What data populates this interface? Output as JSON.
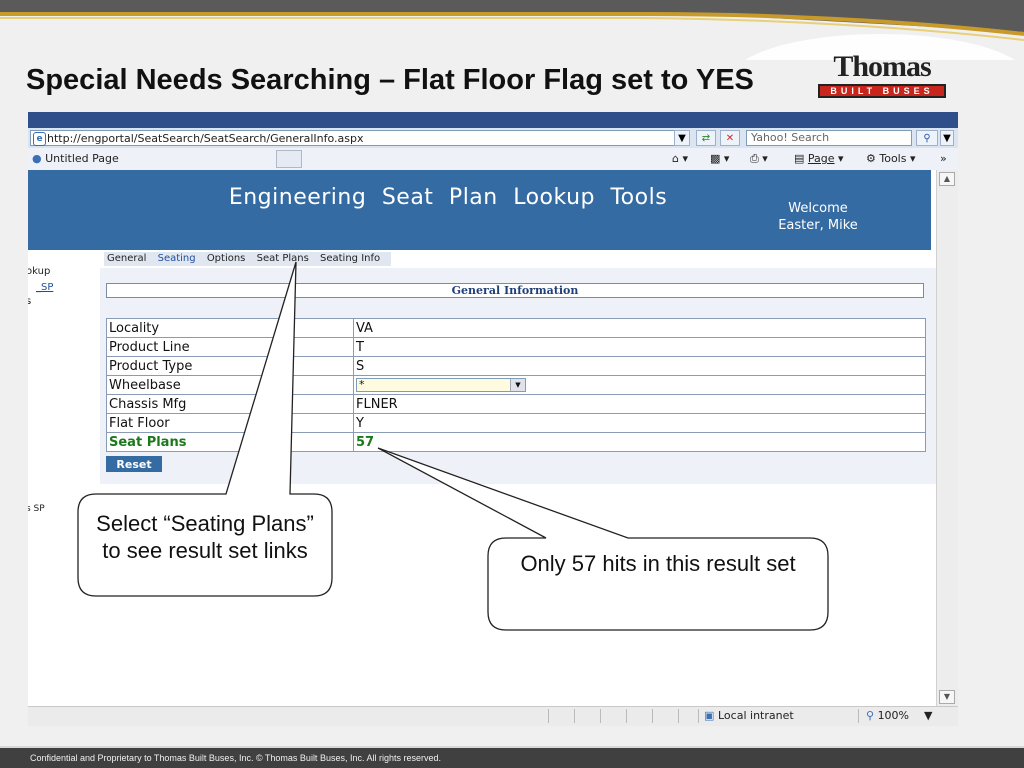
{
  "slide": {
    "title": "Special Needs Searching – Flat Floor Flag set to YES",
    "logo_text": "Thomas",
    "logo_subtext": "BUILT BUSES",
    "footer": "Confidential and Proprietary to Thomas Built Buses, Inc.  © Thomas Built Buses, Inc.  All rights reserved."
  },
  "browser": {
    "url": "http://engportal/SeatSearch/SeatSearch/GeneralInfo.aspx",
    "search_placeholder": "Yahoo! Search",
    "tab_title": "Untitled Page",
    "page_menu": "Page",
    "tools_menu": "Tools",
    "status_zone": "Local intranet",
    "zoom": "100%"
  },
  "app": {
    "title": "Engineering Seat Plan Lookup Tools",
    "welcome": "Welcome",
    "user": "Easter, Mike",
    "left_nav": [
      "okup",
      "_SP",
      "s",
      "s SP"
    ],
    "tabs": [
      {
        "label": "General",
        "active": false
      },
      {
        "label": "Seating",
        "active": true
      },
      {
        "label": "Options",
        "active": false
      },
      {
        "label": "Seat Plans",
        "active": false
      },
      {
        "label": "Seating Info",
        "active": false
      }
    ],
    "section_header": "General Information",
    "fields": [
      {
        "label": "Locality",
        "value": "VA"
      },
      {
        "label": "Product Line",
        "value": "T"
      },
      {
        "label": "Product Type",
        "value": "S"
      },
      {
        "label": "Wheelbase",
        "value": "*"
      },
      {
        "label": "Chassis Mfg",
        "value": "FLNER"
      },
      {
        "label": "Flat Floor",
        "value": "Y"
      },
      {
        "label": "Seat Plans",
        "value": "57"
      }
    ],
    "reset_label": "Reset"
  },
  "callouts": {
    "seating_plans": "Select “Seating Plans” to see result set links",
    "hits": "Only 57 hits in this result set"
  }
}
